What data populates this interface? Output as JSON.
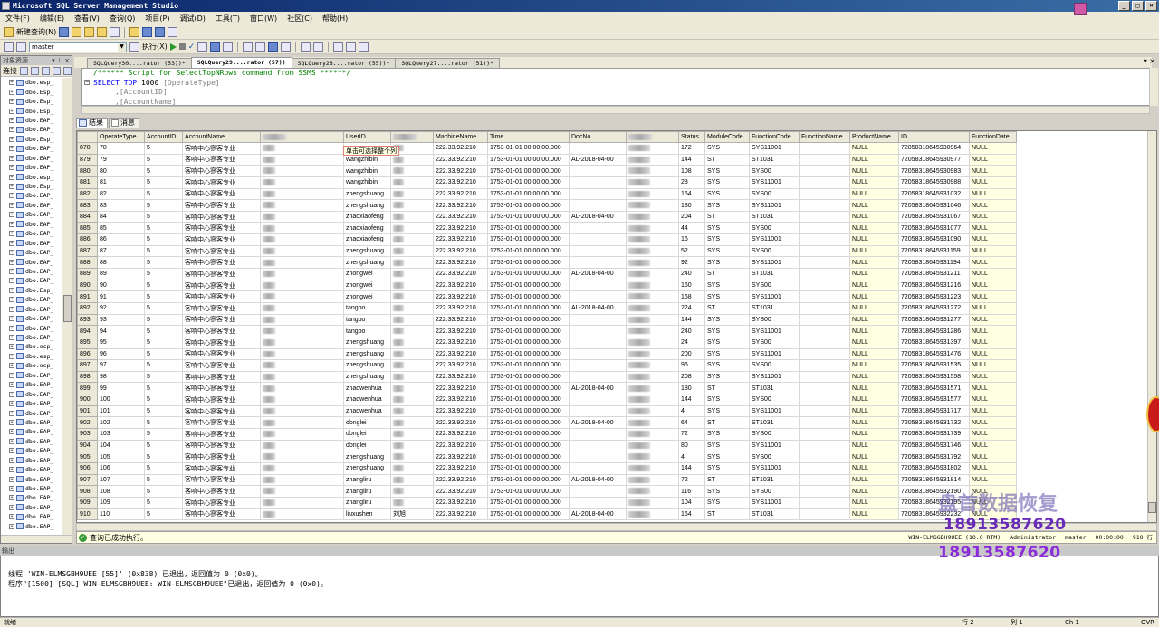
{
  "window": {
    "title": "Microsoft SQL Server Management Studio"
  },
  "menu": [
    "文件(F)",
    "编辑(E)",
    "查看(V)",
    "查询(Q)",
    "项目(P)",
    "调试(D)",
    "工具(T)",
    "窗口(W)",
    "社区(C)",
    "帮助(H)"
  ],
  "toolbar": {
    "new_query": "新建查询(N)",
    "database": "master",
    "execute": "执行(X)"
  },
  "object_explorer": {
    "title": "对象资源...",
    "connect": "连接",
    "items": [
      "dbo.esp_",
      "dbo.Esp_",
      "dbo.Esp_",
      "dbo.Esp_",
      "dbo.EAP_",
      "dbo.EAP_",
      "dbo.Esp_",
      "dbo.EAP_",
      "dbo.EAP_",
      "dbo.EAP_",
      "dbo.esp_",
      "dbo.Esp_",
      "dbo.EAP_",
      "dbo.EAP_",
      "dbo.EAP_",
      "dbo.EAP_",
      "dbo.EAP_",
      "dbo.EAP_",
      "dbo.EAP_",
      "dbo.EAP_",
      "dbo.EAP_",
      "dbo.EAP_",
      "dbo.Esp_",
      "dbo.EAP_",
      "dbo.EAP_",
      "dbo.EAP_",
      "dbo.EAP_",
      "dbo.EAP_",
      "dbo.esp_",
      "dbo.esp_",
      "dbo.esp_",
      "dbo.EAP_",
      "dbo.EAP_",
      "dbo.EAP_",
      "dbo.EAP_",
      "dbo.EAP_",
      "dbo.EAP_",
      "dbo.EAP_",
      "dbo.EAP_",
      "dbo.EAP_",
      "dbo.EAP_",
      "dbo.EAP_",
      "dbo.EAP_",
      "dbo.EAP_",
      "dbo.EAP_",
      "dbo.EAP_",
      "dbo.EAP_",
      "dbo.EAP_"
    ]
  },
  "tabs": [
    {
      "label": "SQLQuery30....rator (53))*",
      "active": false
    },
    {
      "label": "SQLQuery29....rator (57))",
      "active": true
    },
    {
      "label": "SQLQuery28....rator (55))*",
      "active": false
    },
    {
      "label": "SQLQuery27....rator (51))*",
      "active": false
    }
  ],
  "editor": {
    "line1": "/****** Script for SelectTopNRows command from SSMS  ******/",
    "line2_kw": "SELECT TOP",
    "line2_num": "1000",
    "line2_id": "[OperateType]",
    "line3": ",[AccountID]",
    "line4": ",[AccountName]"
  },
  "results_tabs": {
    "results": "结果",
    "messages": "消息"
  },
  "grid": {
    "columns": [
      "OperateType",
      "AccountID",
      "AccountName",
      "",
      "UserID",
      "",
      "MachineName",
      "Time",
      "DocNo",
      "",
      "Status",
      "ModuleCode",
      "FunctionCode",
      "FunctionName",
      "ProductName",
      "ID",
      "FunctionDate"
    ],
    "tooltip": "单击可选择整个列",
    "rows": [
      [
        "878",
        "78",
        "5",
        "客响中心寥客专业",
        "",
        "",
        "",
        "222.33.92.210",
        "1753-01-01 00:00:00.000",
        "",
        "",
        "172",
        "SYS",
        "SYS11001",
        "",
        "NULL",
        "72058318645930964",
        "NULL"
      ],
      [
        "879",
        "79",
        "5",
        "客响中心寥客专业",
        "",
        "wangzhibin",
        "",
        "222.33.92.210",
        "1753-01-01 00:00:00.000",
        "AL-2018-04-00",
        "",
        "144",
        "ST",
        "ST1031",
        "",
        "NULL",
        "72058318645930977",
        "NULL"
      ],
      [
        "880",
        "80",
        "5",
        "客响中心寥客专业",
        "",
        "wangzhibin",
        "",
        "222.33.92.210",
        "1753-01-01 00:00:00.000",
        "",
        "",
        "108",
        "SYS",
        "SYS00",
        "",
        "NULL",
        "72058318645930983",
        "NULL"
      ],
      [
        "881",
        "81",
        "5",
        "客响中心寥客专业",
        "",
        "wangzhibin",
        "",
        "222.33.92.210",
        "1753-01-01 00:00:00.000",
        "",
        "",
        "28",
        "SYS",
        "SYS11001",
        "",
        "NULL",
        "72058318645930988",
        "NULL"
      ],
      [
        "882",
        "82",
        "5",
        "客响中心寥客专业",
        "",
        "zhengshuang",
        "",
        "222.33.92.210",
        "1753-01-01 00:00:00.000",
        "",
        "",
        "164",
        "SYS",
        "SYS00",
        "",
        "NULL",
        "72058318645931032",
        "NULL"
      ],
      [
        "883",
        "83",
        "5",
        "客响中心寥客专业",
        "",
        "zhengshuang",
        "",
        "222.33.92.210",
        "1753-01-01 00:00:00.000",
        "",
        "",
        "180",
        "SYS",
        "SYS11001",
        "",
        "NULL",
        "72058318645931046",
        "NULL"
      ],
      [
        "884",
        "84",
        "5",
        "客响中心寥客专业",
        "",
        "zhaoxiaofeng",
        "",
        "222.33.92.210",
        "1753-01-01 00:00:00.000",
        "AL-2018-04-00",
        "",
        "204",
        "ST",
        "ST1031",
        "",
        "NULL",
        "72058318645931067",
        "NULL"
      ],
      [
        "885",
        "85",
        "5",
        "客响中心寥客专业",
        "",
        "zhaoxiaofeng",
        "",
        "222.33.92.210",
        "1753-01-01 00:00:00.000",
        "",
        "",
        "44",
        "SYS",
        "SYS00",
        "",
        "NULL",
        "72058318645931077",
        "NULL"
      ],
      [
        "886",
        "86",
        "5",
        "客响中心寥客专业",
        "",
        "zhaoxiaofeng",
        "",
        "222.33.92.210",
        "1753-01-01 00:00:00.000",
        "",
        "",
        "16",
        "SYS",
        "SYS11001",
        "",
        "NULL",
        "72058318645931090",
        "NULL"
      ],
      [
        "887",
        "87",
        "5",
        "客响中心寥客专业",
        "",
        "zhengshuang",
        "",
        "222.33.92.210",
        "1753-01-01 00:00:00.000",
        "",
        "",
        "52",
        "SYS",
        "SYS00",
        "",
        "NULL",
        "72058318645931159",
        "NULL"
      ],
      [
        "888",
        "88",
        "5",
        "客响中心寥客专业",
        "",
        "zhengshuang",
        "",
        "222.33.92.210",
        "1753-01-01 00:00:00.000",
        "",
        "",
        "92",
        "SYS",
        "SYS11001",
        "",
        "NULL",
        "72058318645931194",
        "NULL"
      ],
      [
        "889",
        "89",
        "5",
        "客响中心寥客专业",
        "",
        "zhongwei",
        "",
        "222.33.92.210",
        "1753-01-01 00:00:00.000",
        "AL-2018-04-00",
        "",
        "240",
        "ST",
        "ST1031",
        "",
        "NULL",
        "72058318645931211",
        "NULL"
      ],
      [
        "890",
        "90",
        "5",
        "客响中心寥客专业",
        "",
        "zhongwei",
        "",
        "222.33.92.210",
        "1753-01-01 00:00:00.000",
        "",
        "",
        "160",
        "SYS",
        "SYS00",
        "",
        "NULL",
        "72058318645931216",
        "NULL"
      ],
      [
        "891",
        "91",
        "5",
        "客响中心寥客专业",
        "",
        "zhongwei",
        "",
        "222.33.92.210",
        "1753-01-01 00:00:00.000",
        "",
        "",
        "168",
        "SYS",
        "SYS11001",
        "",
        "NULL",
        "72058318645931223",
        "NULL"
      ],
      [
        "892",
        "92",
        "5",
        "客响中心寥客专业",
        "",
        "tangbo",
        "",
        "222.33.92.210",
        "1753-01-01 00:00:00.000",
        "AL-2018-04-00",
        "",
        "224",
        "ST",
        "ST1031",
        "",
        "NULL",
        "72058318645931272",
        "NULL"
      ],
      [
        "893",
        "93",
        "5",
        "客响中心寥客专业",
        "",
        "tangbo",
        "",
        "222.33.92.210",
        "1753-01-01 00:00:00.000",
        "",
        "",
        "144",
        "SYS",
        "SYS00",
        "",
        "NULL",
        "72058318645931277",
        "NULL"
      ],
      [
        "894",
        "94",
        "5",
        "客响中心寥客专业",
        "",
        "tangbo",
        "",
        "222.33.92.210",
        "1753-01-01 00:00:00.000",
        "",
        "",
        "240",
        "SYS",
        "SYS11001",
        "",
        "NULL",
        "72058318645931286",
        "NULL"
      ],
      [
        "895",
        "95",
        "5",
        "客响中心寥客专业",
        "",
        "zhengshuang",
        "",
        "222.33.92.210",
        "1753-01-01 00:00:00.000",
        "",
        "",
        "24",
        "SYS",
        "SYS00",
        "",
        "NULL",
        "72058318645931397",
        "NULL"
      ],
      [
        "896",
        "96",
        "5",
        "客响中心寥客专业",
        "",
        "zhengshuang",
        "",
        "222.33.92.210",
        "1753-01-01 00:00:00.000",
        "",
        "",
        "200",
        "SYS",
        "SYS11001",
        "",
        "NULL",
        "72058318645931476",
        "NULL"
      ],
      [
        "897",
        "97",
        "5",
        "客响中心寥客专业",
        "",
        "zhengshuang",
        "",
        "222.33.92.210",
        "1753-01-01 00:00:00.000",
        "",
        "",
        "96",
        "SYS",
        "SYS00",
        "",
        "NULL",
        "72058318645931535",
        "NULL"
      ],
      [
        "898",
        "98",
        "5",
        "客响中心寥客专业",
        "",
        "zhengshuang",
        "",
        "222.33.92.210",
        "1753-01-01 00:00:00.000",
        "",
        "",
        "208",
        "SYS",
        "SYS11001",
        "",
        "NULL",
        "72058318645931558",
        "NULL"
      ],
      [
        "899",
        "99",
        "5",
        "客响中心寥客专业",
        "",
        "zhaowenhua",
        "",
        "222.33.92.210",
        "1753-01-01 00:00:00.000",
        "AL-2018-04-00",
        "",
        "180",
        "ST",
        "ST1031",
        "",
        "NULL",
        "72058318645931571",
        "NULL"
      ],
      [
        "900",
        "100",
        "5",
        "客响中心寥客专业",
        "",
        "zhaowenhua",
        "",
        "222.33.92.210",
        "1753-01-01 00:00:00.000",
        "",
        "",
        "144",
        "SYS",
        "SYS00",
        "",
        "NULL",
        "72058318645931577",
        "NULL"
      ],
      [
        "901",
        "101",
        "5",
        "客响中心寥客专业",
        "",
        "zhaowenhua",
        "",
        "222.33.92.210",
        "1753-01-01 00:00:00.000",
        "",
        "",
        "4",
        "SYS",
        "SYS11001",
        "",
        "NULL",
        "72058318645931717",
        "NULL"
      ],
      [
        "902",
        "102",
        "5",
        "客响中心寥客专业",
        "",
        "donglei",
        "",
        "222.33.92.210",
        "1753-01-01 00:00:00.000",
        "AL-2018-04-00",
        "",
        "64",
        "ST",
        "ST1031",
        "",
        "NULL",
        "72058318645931732",
        "NULL"
      ],
      [
        "903",
        "103",
        "5",
        "客响中心寥客专业",
        "",
        "donglei",
        "",
        "222.33.92.210",
        "1753-01-01 00:00:00.000",
        "",
        "",
        "72",
        "SYS",
        "SYS00",
        "",
        "NULL",
        "72058318645931739",
        "NULL"
      ],
      [
        "904",
        "104",
        "5",
        "客响中心寥客专业",
        "",
        "donglei",
        "",
        "222.33.92.210",
        "1753-01-01 00:00:00.000",
        "",
        "",
        "80",
        "SYS",
        "SYS11001",
        "",
        "NULL",
        "72058318645931746",
        "NULL"
      ],
      [
        "905",
        "105",
        "5",
        "客响中心寥客专业",
        "",
        "zhengshuang",
        "",
        "222.33.92.210",
        "1753-01-01 00:00:00.000",
        "",
        "",
        "4",
        "SYS",
        "SYS00",
        "",
        "NULL",
        "72058318645931792",
        "NULL"
      ],
      [
        "906",
        "106",
        "5",
        "客响中心寥客专业",
        "",
        "zhengshuang",
        "",
        "222.33.92.210",
        "1753-01-01 00:00:00.000",
        "",
        "",
        "144",
        "SYS",
        "SYS11001",
        "",
        "NULL",
        "72058318645931802",
        "NULL"
      ],
      [
        "907",
        "107",
        "5",
        "客响中心寥客专业",
        "",
        "zhangliru",
        "",
        "222.33.92.210",
        "1753-01-01 00:00:00.000",
        "AL-2018-04-00",
        "",
        "72",
        "ST",
        "ST1031",
        "",
        "NULL",
        "72058318645931814",
        "NULL"
      ],
      [
        "908",
        "108",
        "5",
        "客响中心寥客专业",
        "",
        "zhangliru",
        "",
        "222.33.92.210",
        "1753-01-01 00:00:00.000",
        "",
        "",
        "116",
        "SYS",
        "SYS00",
        "",
        "NULL",
        "72058318645932190",
        "NULL"
      ],
      [
        "909",
        "109",
        "5",
        "客响中心寥客专业",
        "",
        "zhangliru",
        "",
        "222.33.92.210",
        "1753-01-01 00:00:00.000",
        "",
        "",
        "104",
        "SYS",
        "SYS11001",
        "",
        "NULL",
        "72058318645932195",
        "NULL"
      ],
      [
        "910",
        "110",
        "5",
        "客响中心寥客专业",
        "",
        "liuxushen",
        "刘旭",
        "222.33.92.210",
        "1753-01-01 00:00:00.000",
        "AL-2018-04-00",
        "",
        "164",
        "ST",
        "ST1031",
        "",
        "NULL",
        "72058318645932232",
        "NULL"
      ]
    ]
  },
  "query_status": {
    "message": "查询已成功执行。",
    "server": "WIN-ELMSGBH9UEE (10.0 RTM)",
    "user": "Administrator",
    "db": "master",
    "elapsed": "00:00:00",
    "rows": "910 行"
  },
  "output": {
    "title": "输出",
    "line1": "线程 'WIN-ELMSGBH9UEE [55]' (0x838) 已退出，返回值为 0 (0x0)。",
    "line2": "程序\"[1500] [SQL] WIN-ELMSGBH9UEE: WIN-ELMSGBH9UEE\"已退出，返回值为 0 (0x0)。"
  },
  "statusbar": {
    "ready": "就绪",
    "line": "行 2",
    "col": "列 1",
    "ch": "Ch 1",
    "mode": "OVR"
  },
  "watermark": {
    "line1": "盘首数据恢复",
    "phone1": "18913587620",
    "phone2": "18913587620"
  }
}
